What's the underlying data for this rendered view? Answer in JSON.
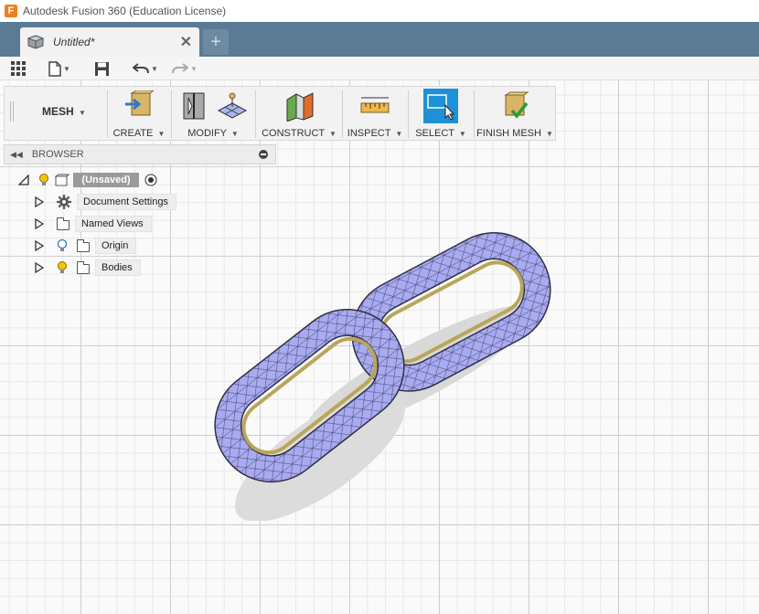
{
  "app": {
    "title": "Autodesk Fusion 360 (Education License)",
    "logo_letter": "F"
  },
  "tabs": [
    {
      "label": "Untitled*",
      "close": "✕"
    }
  ],
  "new_tab_label": "+",
  "ribbon": {
    "workspace": "MESH",
    "groups": [
      {
        "label": "CREATE"
      },
      {
        "label": "MODIFY"
      },
      {
        "label": "CONSTRUCT"
      },
      {
        "label": "INSPECT"
      },
      {
        "label": "SELECT"
      },
      {
        "label": "FINISH MESH"
      }
    ]
  },
  "browser": {
    "title": "BROWSER",
    "root": "(Unsaved)",
    "items": [
      {
        "label": "Document Settings"
      },
      {
        "label": "Named Views"
      },
      {
        "label": "Origin"
      },
      {
        "label": "Bodies"
      }
    ]
  },
  "colors": {
    "tab_strip": "#5b7a93",
    "select_active": "#1e90d8",
    "mesh_fill": "#a9abf0",
    "mesh_underside": "#b9a65a"
  }
}
